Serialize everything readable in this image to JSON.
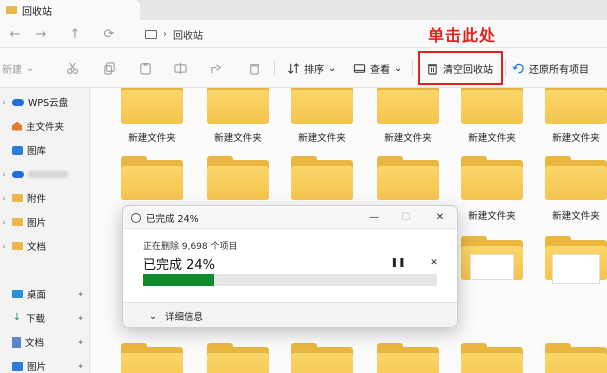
{
  "tab": {
    "title": "回收站"
  },
  "address": {
    "crumb": "回收站"
  },
  "annotation": "单击此处",
  "toolbar": {
    "new_label": "新建",
    "sort_label": "排序",
    "view_label": "查看",
    "empty_recycle_label": "清空回收站",
    "restore_all_label": "还原所有项目"
  },
  "sidebar": {
    "items": [
      {
        "label": "WPS云盘"
      },
      {
        "label": "主文件夹"
      },
      {
        "label": "图库"
      },
      {
        "label": ""
      },
      {
        "label": "附件"
      },
      {
        "label": "图片"
      },
      {
        "label": "文档"
      },
      {
        "label": "桌面"
      },
      {
        "label": "下载"
      },
      {
        "label": "文档"
      },
      {
        "label": "图片"
      }
    ]
  },
  "folders": {
    "row1_label": "新建文件夹",
    "row2_label": "新建文件夹"
  },
  "dialog": {
    "title": "已完成 24%",
    "subtitle": "正在删除 9,698 个项目",
    "big": "已完成 24%",
    "progress": 0.24,
    "more": "详细信息",
    "accent": "#0f8a2c"
  },
  "colors": {
    "annotation_red": "#e0231c",
    "folder": "#f4c44d"
  }
}
